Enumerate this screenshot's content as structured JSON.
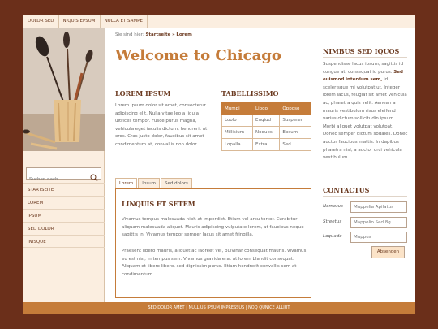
{
  "topnav": {
    "items": [
      "DOLOR SED",
      "NIQUIS EPSUM",
      "NULLA ET SAMPE"
    ]
  },
  "search": {
    "placeholder": "Suchen nach ..."
  },
  "leftnav": {
    "items": [
      "STARTSEITE",
      "LOREM",
      "IPSUM",
      "SED DOLOR",
      "INISQUE"
    ]
  },
  "breadcrumb": {
    "prefix": "Sie sind hier:",
    "link": "Startseite",
    "separator": "»",
    "current": "Lorem"
  },
  "main": {
    "title": "Welcome to Chicago",
    "lorem_heading": "LOREM IPSUM",
    "lorem_text": "Lorem ipsum dolor sit amet, consectetur adipiscing elit. Nulla vitae leo a ligula ultrices tempor. Fusce purus magna, vehicula eget iaculis dictum, hendrerit ut eros. Cras justo dolor, faucibus sit amet condimentum at, convallis non dolor.",
    "table_heading": "TABELLISSIMO",
    "table": {
      "headers": [
        "Mumpi",
        "Lipqo",
        "Opposo"
      ],
      "rows": [
        [
          "Loolo",
          "Enqiud",
          "Susperer"
        ],
        [
          "Millisium",
          "Noques",
          "Epsum"
        ],
        [
          "Lopalla",
          "Extra",
          "Sed"
        ]
      ]
    },
    "tabs": [
      "Lorem",
      "Ipsum",
      "Sed dolors"
    ],
    "tab_heading": "LINQUIS ET SETEM",
    "tab_p1": "Vivamus tempus malesuada nibh at imperdiet. Etiam vel arcu tortor. Curabitur aliquam malesuada aliquet. Mauris adipiscing vulputate lorem, at faucibus neque sagittis in. Vivamus tempor semper lacus sit amet fringilla.",
    "tab_p2": "Praesent libero mauris, aliquet ac laoreet vel, pulvinar consequat mauris. Vivamus eu est nisi, in tempus sem. Vivamus gravida erat at lorem blandit consequat. Aliquam et libero libero, sed dignissim purus. Etiam hendrerit convallis sem at condimentum."
  },
  "right": {
    "nimbus_heading": "NIMBUS SED IQUOS",
    "nimbus_p_before": "Suspendisse lacus ipsum, sagittis id congue at, consequat id purus.",
    "nimbus_p_bold": "Sed euismod interdum sem,",
    "nimbus_p_after": "id scelerisque mi volutpat ut. Integer lorem lacus, feugiat sit amet vehicula ac, pharetra quis velit. Aenean a mauris vestibulum risus eleifend varius dictum sollicitudin ipsum. Morbi aliquet volutpat volutpat. Donec semper dictum sodales. Donec auctor faucibus mattis. In dapibus pharetra nisl, a auctor orci vehicula vestibulum",
    "contact_heading": "CONTACTUS",
    "form": [
      {
        "label": "Nomerus",
        "value": "Muppelia Apilatus"
      },
      {
        "label": "Streetus",
        "value": "Mappolio Sed 8g"
      },
      {
        "label": "Loquado",
        "value": "Muppus"
      }
    ],
    "send_label": "Absenden"
  },
  "footer": {
    "text": "SED DOLOR AMET | NULLIUS IPSUM IMPRESSUS | NOQ QUNICE ALLIUT"
  },
  "colors": {
    "background": "#6b2f1a",
    "accent": "#c57c3a",
    "panel": "#fbeee0"
  }
}
